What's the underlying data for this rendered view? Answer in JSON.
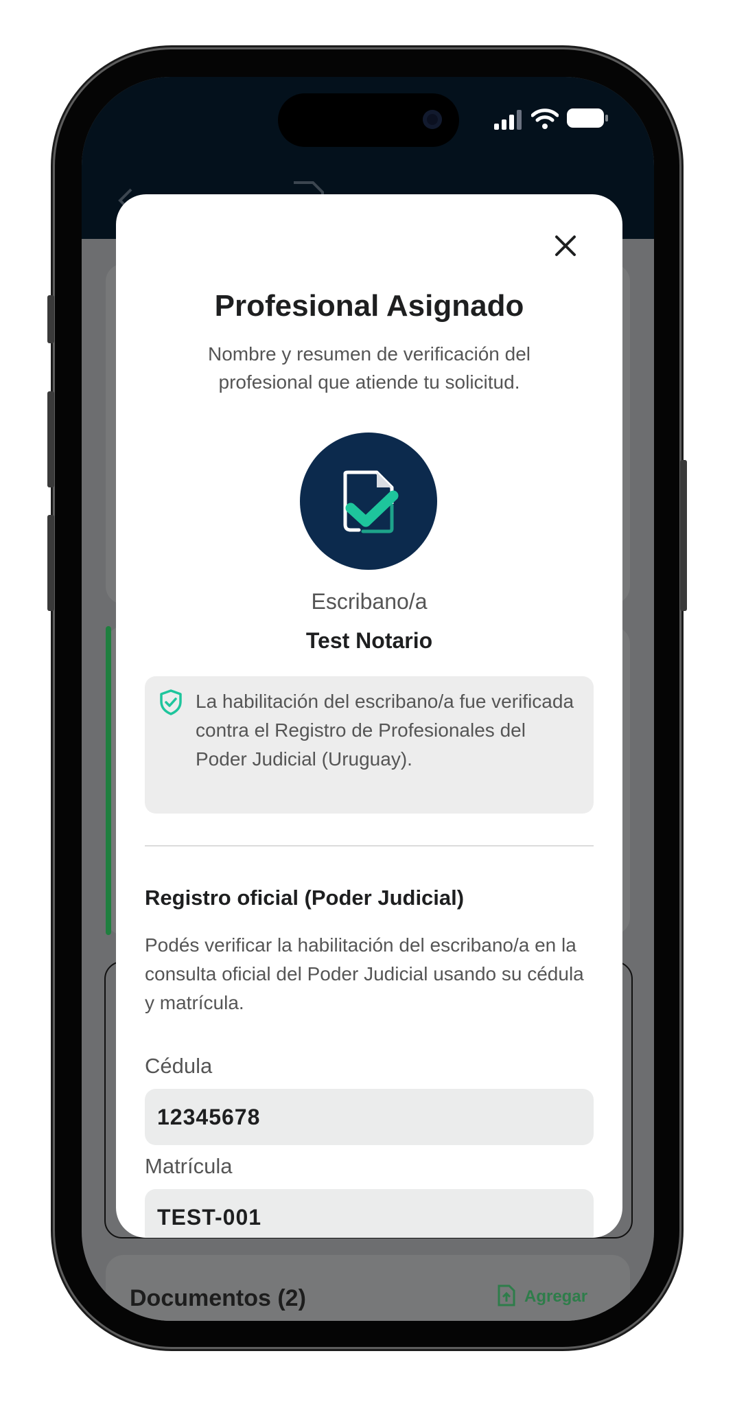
{
  "background": {
    "documents_label": "Documentos (2)",
    "add_label": "Agregar"
  },
  "modal": {
    "title": "Profesional Asignado",
    "subtitle": "Nombre y resumen de verificación del profesional que atiende tu solicitud.",
    "avatar_icon": "document-check-icon",
    "role": "Escribano/a",
    "name": "Test Notario",
    "verification_note": "La habilitación del escribano/a fue verificada contra el Registro de Profesionales del Poder Judicial (Uruguay).",
    "registry": {
      "title": "Registro oficial (Poder Judicial)",
      "description": "Podés verificar la habilitación del escribano/a en la consulta oficial del Poder Judicial usando su cédula y matrícula.",
      "cedula_label": "Cédula",
      "cedula_value": "12345678",
      "matricula_label": "Matrícula",
      "matricula_value": "TEST-001"
    }
  },
  "colors": {
    "header": "#04111c",
    "avatar": "#0c2a4d",
    "check_accent": "#1ec59c",
    "shield": "#1ec59c"
  }
}
